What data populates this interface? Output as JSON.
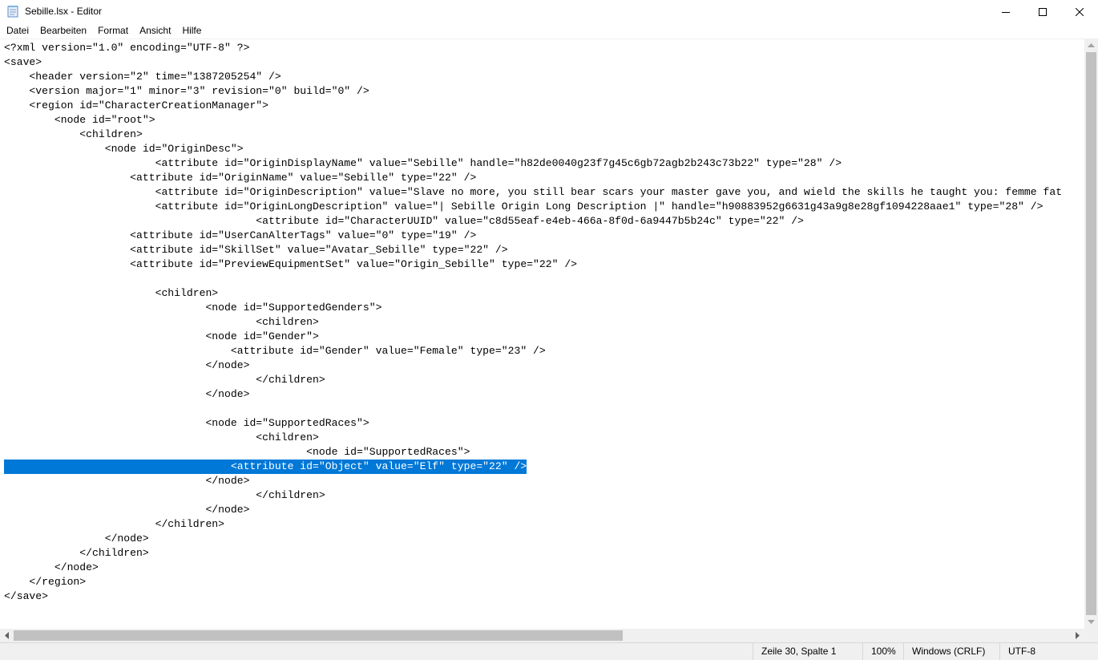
{
  "window": {
    "title": "Sebille.lsx - Editor",
    "minimize_icon": "minimize-icon",
    "maximize_icon": "maximize-icon",
    "close_icon": "close-icon"
  },
  "menu": [
    "Datei",
    "Bearbeiten",
    "Format",
    "Ansicht",
    "Hilfe"
  ],
  "editor": {
    "lines": [
      "<?xml version=\"1.0\" encoding=\"UTF-8\" ?>",
      "<save>",
      "    <header version=\"2\" time=\"1387205254\" />",
      "    <version major=\"1\" minor=\"3\" revision=\"0\" build=\"0\" />",
      "    <region id=\"CharacterCreationManager\">",
      "        <node id=\"root\">",
      "            <children>",
      "                <node id=\"OriginDesc\">",
      "                        <attribute id=\"OriginDisplayName\" value=\"Sebille\" handle=\"h82de0040g23f7g45c6gb72agb2b243c73b22\" type=\"28\" />",
      "                    <attribute id=\"OriginName\" value=\"Sebille\" type=\"22\" />",
      "                        <attribute id=\"OriginDescription\" value=\"Slave no more, you still bear scars your master gave you, and wield the skills he taught you: femme fat",
      "                        <attribute id=\"OriginLongDescription\" value=\"| Sebille Origin Long Description |\" handle=\"h90883952g6631g43a9g8e28gf1094228aae1\" type=\"28\" />",
      "                                        <attribute id=\"CharacterUUID\" value=\"c8d55eaf-e4eb-466a-8f0d-6a9447b5b24c\" type=\"22\" />",
      "                    <attribute id=\"UserCanAlterTags\" value=\"0\" type=\"19\" />",
      "                    <attribute id=\"SkillSet\" value=\"Avatar_Sebille\" type=\"22\" />",
      "                    <attribute id=\"PreviewEquipmentSet\" value=\"Origin_Sebille\" type=\"22\" />",
      "",
      "                        <children>",
      "                                <node id=\"SupportedGenders\">",
      "                                        <children>",
      "                                <node id=\"Gender\">",
      "                                    <attribute id=\"Gender\" value=\"Female\" type=\"23\" />",
      "                                </node>",
      "                                        </children>",
      "                                </node>",
      "",
      "                                <node id=\"SupportedRaces\">",
      "                                        <children>",
      "                                                <node id=\"SupportedRaces\">",
      "                                    <attribute id=\"Object\" value=\"Elf\" type=\"22\" />",
      "                                </node>",
      "                                        </children>",
      "                                </node>",
      "                        </children>",
      "                </node>",
      "            </children>",
      "        </node>",
      "    </region>",
      "</save>"
    ],
    "selected_line_index": 29
  },
  "status": {
    "position": "Zeile 30, Spalte 1",
    "zoom": "100%",
    "line_ending": "Windows (CRLF)",
    "encoding": "UTF-8"
  }
}
